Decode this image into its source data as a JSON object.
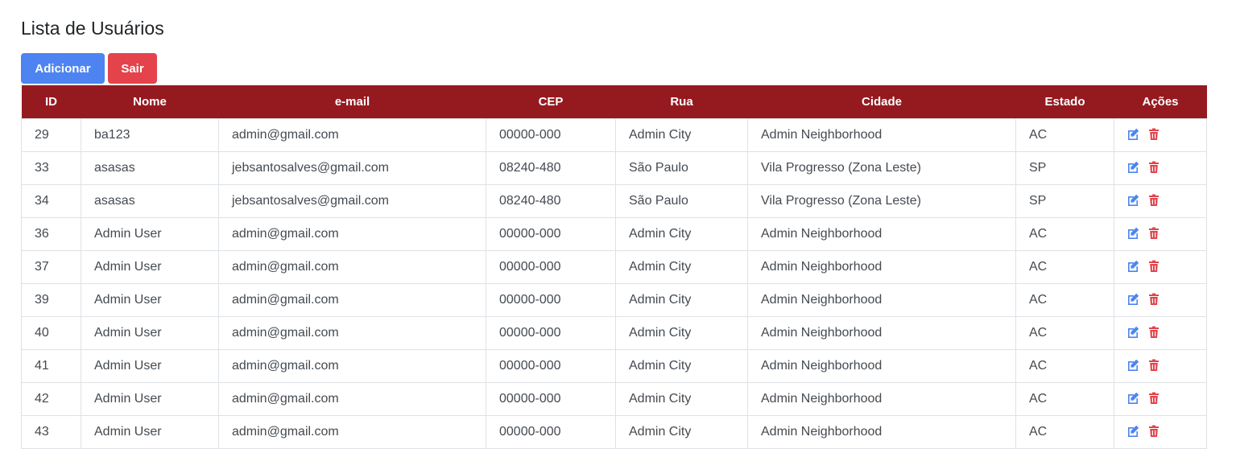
{
  "page": {
    "title": "Lista de Usuários"
  },
  "toolbar": {
    "add_label": "Adicionar",
    "exit_label": "Sair"
  },
  "colors": {
    "header_bg": "#951a20",
    "add_button": "#4d84f1",
    "exit_button": "#e4434b",
    "edit_icon": "#4d84f1",
    "delete_icon": "#e4434b"
  },
  "icons": {
    "edit": "edit-icon",
    "delete": "trash-icon"
  },
  "table": {
    "headers": [
      "ID",
      "Nome",
      "e-mail",
      "CEP",
      "Rua",
      "Cidade",
      "Estado",
      "Ações"
    ],
    "rows": [
      [
        "29",
        "ba123",
        "admin@gmail.com",
        "00000-000",
        "Admin City",
        "Admin Neighborhood",
        "AC"
      ],
      [
        "33",
        "asasas",
        "jebsantosalves@gmail.com",
        "08240-480",
        "São Paulo",
        "Vila Progresso (Zona Leste)",
        "SP"
      ],
      [
        "34",
        "asasas",
        "jebsantosalves@gmail.com",
        "08240-480",
        "São Paulo",
        "Vila Progresso (Zona Leste)",
        "SP"
      ],
      [
        "36",
        "Admin User",
        "admin@gmail.com",
        "00000-000",
        "Admin City",
        "Admin Neighborhood",
        "AC"
      ],
      [
        "37",
        "Admin User",
        "admin@gmail.com",
        "00000-000",
        "Admin City",
        "Admin Neighborhood",
        "AC"
      ],
      [
        "39",
        "Admin User",
        "admin@gmail.com",
        "00000-000",
        "Admin City",
        "Admin Neighborhood",
        "AC"
      ],
      [
        "40",
        "Admin User",
        "admin@gmail.com",
        "00000-000",
        "Admin City",
        "Admin Neighborhood",
        "AC"
      ],
      [
        "41",
        "Admin User",
        "admin@gmail.com",
        "00000-000",
        "Admin City",
        "Admin Neighborhood",
        "AC"
      ],
      [
        "42",
        "Admin User",
        "admin@gmail.com",
        "00000-000",
        "Admin City",
        "Admin Neighborhood",
        "AC"
      ],
      [
        "43",
        "Admin User",
        "admin@gmail.com",
        "00000-000",
        "Admin City",
        "Admin Neighborhood",
        "AC"
      ]
    ]
  }
}
